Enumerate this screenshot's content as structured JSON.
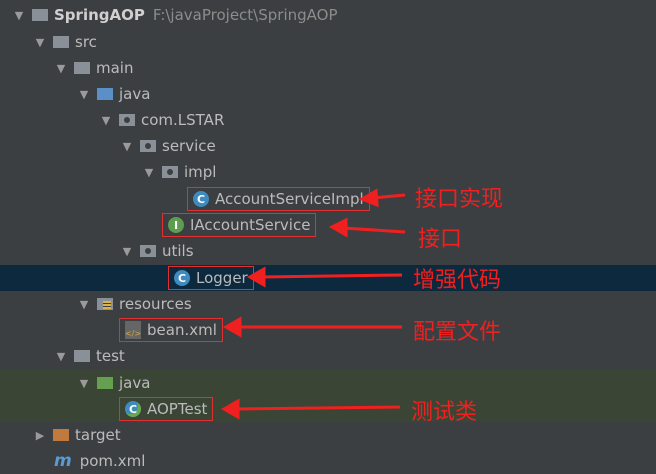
{
  "tree": {
    "root": {
      "label": "SpringAOP",
      "path": "F:\\javaProject\\SpringAOP"
    },
    "src": "src",
    "main": "main",
    "java": "java",
    "package": "com.LSTAR",
    "service": "service",
    "impl": "impl",
    "account_service_impl": "AccountServiceImpl",
    "i_account_service": "IAccountService",
    "utils": "utils",
    "logger": "Logger",
    "resources": "resources",
    "bean_xml": "bean.xml",
    "test": "test",
    "test_java": "java",
    "aop_test": "AOPTest",
    "target": "target",
    "pom_xml": "pom.xml"
  },
  "annotations": {
    "impl_note": "接口实现",
    "interface_note": "接口",
    "advice_note": "增强代码",
    "config_note": "配置文件",
    "test_note": "测试类"
  },
  "colors": {
    "background": "#3c3f41",
    "selected_row": "#0d293e",
    "annotation": "#f02020"
  }
}
